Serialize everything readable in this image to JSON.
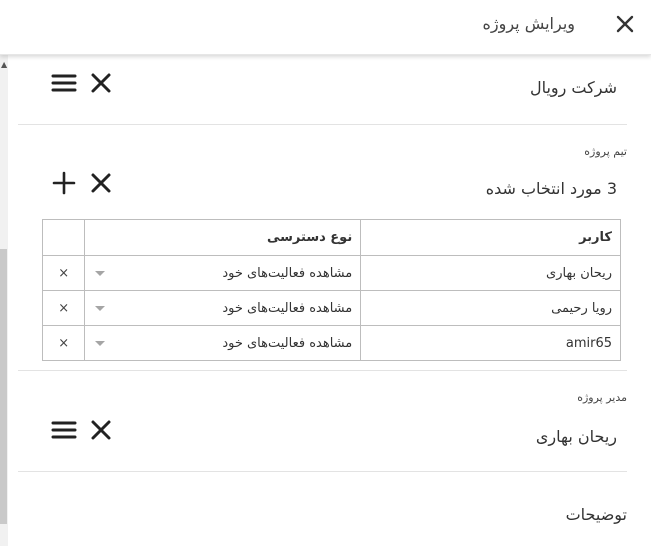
{
  "header": {
    "title": "ویرایش پروژه",
    "close_icon": "close-icon"
  },
  "company": {
    "value": "شرکت رویال",
    "menu_icon": "menu-icon",
    "clear_icon": "close-icon"
  },
  "team": {
    "label": "تیم پروژه",
    "selected_text": "3 مورد انتخاب شده",
    "add_icon": "plus-icon",
    "clear_icon": "close-icon",
    "columns": {
      "user": "کاربر",
      "access": "نوع دسترسی"
    },
    "rows": [
      {
        "user": "ریحان بهاری",
        "access": "مشاهده فعالیت‌های خود",
        "delete": "×"
      },
      {
        "user": "رویا رحیمی",
        "access": "مشاهده فعالیت‌های خود",
        "delete": "×"
      },
      {
        "user": "amir65",
        "access": "مشاهده فعالیت‌های خود",
        "delete": "×"
      }
    ]
  },
  "manager": {
    "label": "مدیر پروژه",
    "value": "ریحان بهاری",
    "menu_icon": "menu-icon",
    "clear_icon": "close-icon"
  },
  "description": {
    "label": "توضیحات"
  }
}
